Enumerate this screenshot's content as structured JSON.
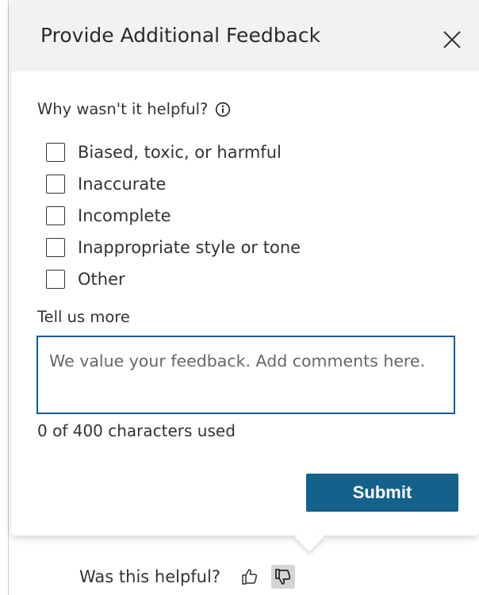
{
  "dialog": {
    "title": "Provide Additional Feedback",
    "close_icon": "close-icon"
  },
  "question": {
    "label": "Why wasn't it helpful?",
    "info_icon": "info-icon"
  },
  "options": [
    {
      "label": "Biased, toxic, or harmful",
      "checked": false
    },
    {
      "label": "Inaccurate",
      "checked": false
    },
    {
      "label": "Incomplete",
      "checked": false
    },
    {
      "label": "Inappropriate style or tone",
      "checked": false
    },
    {
      "label": "Other",
      "checked": false
    }
  ],
  "comment": {
    "label": "Tell us more",
    "placeholder": "We value your feedback. Add comments here.",
    "value": "",
    "counter": "0 of 400 characters used"
  },
  "submit": {
    "label": "Submit"
  },
  "footer": {
    "label": "Was this helpful?",
    "thumbs_up_icon": "thumbs-up-icon",
    "thumbs_down_icon": "thumbs-down-icon",
    "selected": "thumbs-down"
  },
  "colors": {
    "accent": "#17599e",
    "button": "#14618c",
    "header_bg": "#f2f2f2"
  }
}
